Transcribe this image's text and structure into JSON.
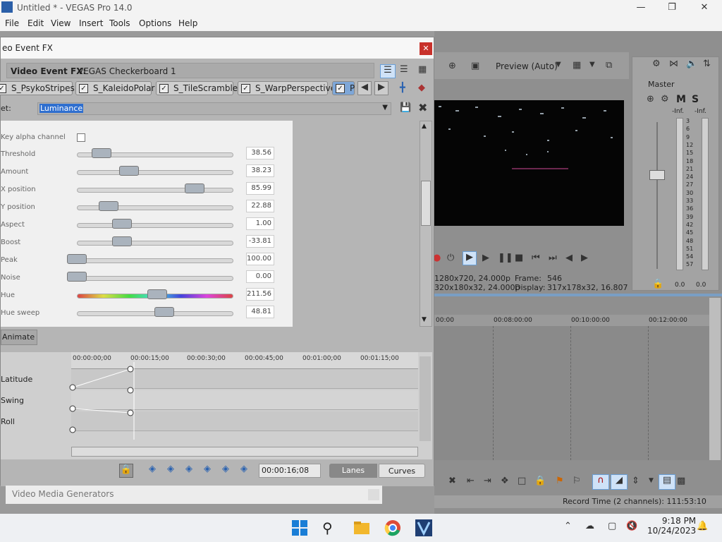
{
  "app": {
    "title": "Untitled * - VEGAS Pro 14.0"
  },
  "menu": [
    "File",
    "Edit",
    "View",
    "Insert",
    "Tools",
    "Options",
    "Help"
  ],
  "dialog": {
    "title": "eo Event FX",
    "fx_label": "Video Event FX:",
    "fx_name": "VEGAS Checkerboard 1",
    "chips": [
      "S_PsykoStripes",
      "S_KaleidoPolar",
      "S_TileScramble",
      "S_WarpPerspective",
      "P"
    ],
    "preset_label": "et:",
    "preset_value": "Luminance",
    "key_alpha_label": "Key alpha channel",
    "params": [
      {
        "label": "Threshold",
        "value": "38.56",
        "fraction": 0.18
      },
      {
        "label": "Amount",
        "value": "38.23",
        "fraction": 0.38
      },
      {
        "label": "X position",
        "value": "85.99",
        "fraction": 0.86
      },
      {
        "label": "Y position",
        "value": "22.88",
        "fraction": 0.23
      },
      {
        "label": "Aspect",
        "value": "1.00",
        "fraction": 0.33
      },
      {
        "label": "Boost",
        "value": "-33.81",
        "fraction": 0.33
      },
      {
        "label": "Peak",
        "value": "100.00",
        "fraction": 0.0
      },
      {
        "label": "Noise",
        "value": "0.00",
        "fraction": 0.0
      },
      {
        "label": "Hue",
        "value": "211.56",
        "fraction": 0.59
      },
      {
        "label": "Hue sweep",
        "value": "48.81",
        "fraction": 0.64
      }
    ],
    "animate_label": "Animate",
    "ruler_ticks": [
      "00:00:00;00",
      "00:00:15;00",
      "00:00:30;00",
      "00:00:45;00",
      "00:01:00;00",
      "00:01:15;00"
    ],
    "lanes": [
      "Latitude",
      "Swing",
      "Roll"
    ],
    "timecode": "00:00:16;08",
    "lanes_btn": "Lanes",
    "curves_btn": "Curves"
  },
  "preview": {
    "mode": "Preview (Auto)",
    "info_line1": "1280x720, 24.000p",
    "frame_label": "Frame:",
    "frame_value": "546",
    "info_line2": "320x180x32, 24.000p",
    "display_label": "Display:",
    "display_value": "317x178x32, 16.807"
  },
  "master": {
    "label": "Master",
    "m": "M",
    "s": "S",
    "inf_left": "-Inf.",
    "inf_right": "-Inf.",
    "scale": [
      "3",
      "6",
      "9",
      "12",
      "15",
      "18",
      "21",
      "24",
      "27",
      "30",
      "33",
      "36",
      "39",
      "42",
      "45",
      "48",
      "51",
      "54",
      "57"
    ],
    "bottom_left": "0.0",
    "bottom_right": "0.0"
  },
  "timeline": {
    "ticks": [
      "00:00",
      "00:08:00:00",
      "00:10:00:00",
      "00:12:00:00"
    ],
    "record_time": "Record Time (2 channels): 111:53:10"
  },
  "generators": {
    "label": "Video Media Generators"
  },
  "taskbar": {
    "time": "9:18 PM",
    "date": "10/24/2023"
  },
  "colors": {
    "accent": "#2f6fcf",
    "close": "#c8312b"
  }
}
